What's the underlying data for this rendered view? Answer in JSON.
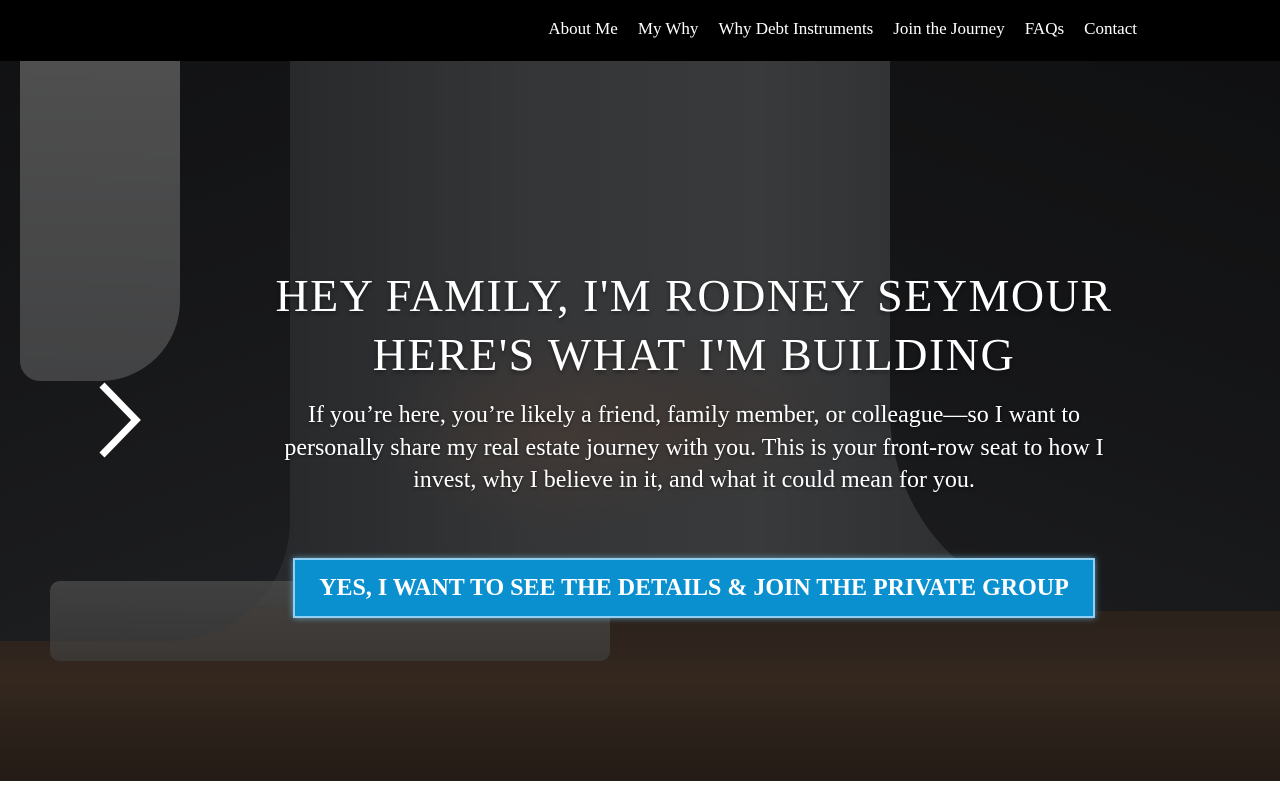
{
  "nav": {
    "items": [
      {
        "label": "About Me"
      },
      {
        "label": "My Why"
      },
      {
        "label": "Why Debt Instruments"
      },
      {
        "label": "Join the Journey"
      },
      {
        "label": "FAQs"
      },
      {
        "label": "Contact"
      }
    ]
  },
  "hero": {
    "headline_line1": "HEY FAMILY, I'M RODNEY SEYMOUR",
    "headline_line2": "HERE'S WHAT I'M BUILDING",
    "subtext": "If you’re here, you’re likely a friend, family member, or colleague—so I want to personally share my real estate journey with you. This is your front-row seat to how I invest, why I believe in it, and what it could mean for you.",
    "cta_label": "YES, I WANT TO SEE THE DETAILS & JOIN THE PRIVATE GROUP",
    "next_arrow_icon": "chevron-right-icon"
  },
  "colors": {
    "nav_background": "#000000",
    "cta_background": "#0a8fcf",
    "text": "#ffffff"
  }
}
